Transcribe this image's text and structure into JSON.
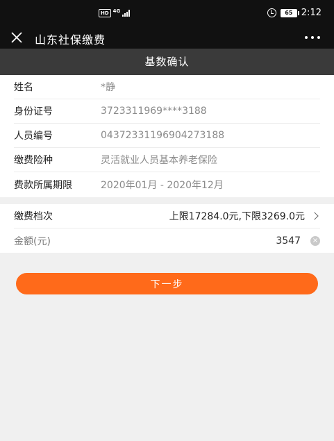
{
  "status_bar": {
    "hd": "HD",
    "network": "4G",
    "battery": "65",
    "time": "2:12"
  },
  "title_bar": {
    "title": "山东社保缴费"
  },
  "page": {
    "header": "基数确认"
  },
  "info": [
    {
      "label": "姓名",
      "value": "*静"
    },
    {
      "label": "身份证号",
      "value": "3723311969****3188"
    },
    {
      "label": "人员编号",
      "value": "04372331196904273188"
    },
    {
      "label": "缴费险种",
      "value": "灵活就业人员基本养老保险"
    },
    {
      "label": "费款所属期限",
      "value": "2020年01月 - 2020年12月"
    }
  ],
  "payment": {
    "level_label": "缴费档次",
    "level_value": "上限17284.0元,下限3269.0元",
    "amount_label": "金额(元)",
    "amount_value": "3547"
  },
  "actions": {
    "next": "下一步"
  },
  "icons": {
    "close": "close-icon",
    "more": "more-icon",
    "chevron": "chevron-right-icon",
    "clear": "clear-icon",
    "alarm": "alarm-icon"
  },
  "colors": {
    "accent": "#ff6a1a",
    "header_bg": "#3a3a3a",
    "bar_bg": "#111111"
  }
}
